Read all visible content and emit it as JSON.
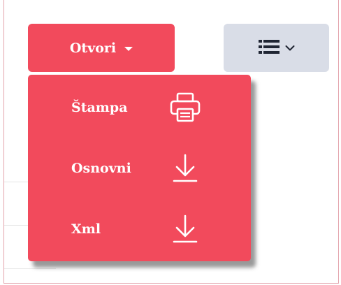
{
  "toolbar": {
    "open_label": "Otvori",
    "open_icon": "caret-down-icon",
    "view_icon": "list-icon",
    "view_chevron": "chevron-down-icon"
  },
  "menu": {
    "items": [
      {
        "label": "Štampa",
        "icon": "printer-icon"
      },
      {
        "label": "Osnovni",
        "icon": "download-icon"
      },
      {
        "label": "Xml",
        "icon": "download-icon"
      }
    ]
  },
  "colors": {
    "accent": "#f24a5c",
    "secondary_button": "#d9dde7",
    "icon_dark": "#1f2533",
    "text_on_accent": "#ffffff"
  }
}
